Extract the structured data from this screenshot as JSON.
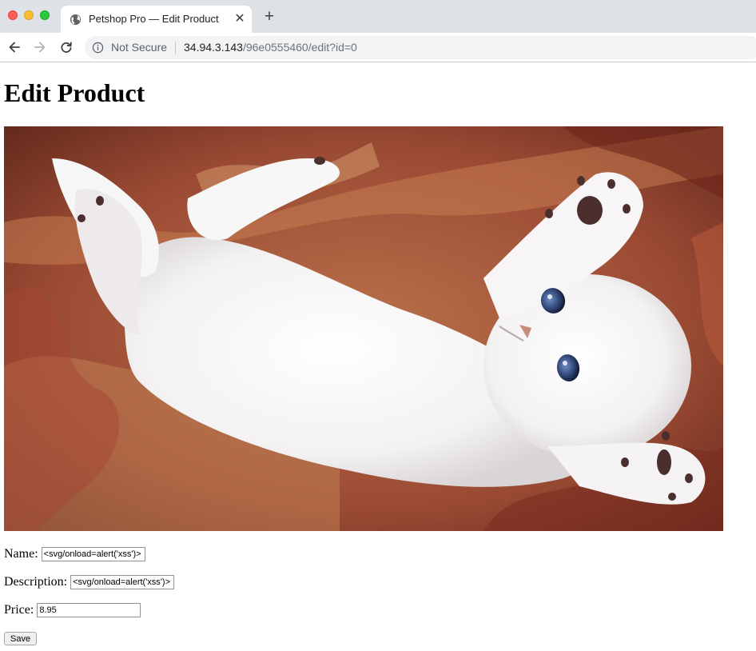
{
  "browser": {
    "tab": {
      "title": "Petshop Pro — Edit Product",
      "close_glyph": "✕"
    },
    "new_tab_glyph": "+",
    "omnibox": {
      "security_label": "Not Secure",
      "url_host": "34.94.3.143",
      "url_path": "/96e0555460/edit?id=0"
    },
    "icons": [
      "globe-icon",
      "back-arrow-icon",
      "forward-arrow-icon",
      "reload-icon",
      "info-icon"
    ],
    "colors": {
      "tabbar": "#dee1e6",
      "omnibox": "#f1f3f4",
      "close_light": "#fe5f57",
      "minimize_light": "#febc2e",
      "maximize_light": "#28c840"
    }
  },
  "page": {
    "title": "Edit Product",
    "image": {
      "subject": "white kitten lying on its back on a red-orange blanket"
    },
    "form": {
      "name_label": "Name:",
      "name_value": "<svg/onload=alert('xss')>",
      "description_label": "Description:",
      "description_value": "<svg/onload=alert('xss')>",
      "price_label": "Price:",
      "price_value": "8.95",
      "save_label": "Save"
    }
  }
}
